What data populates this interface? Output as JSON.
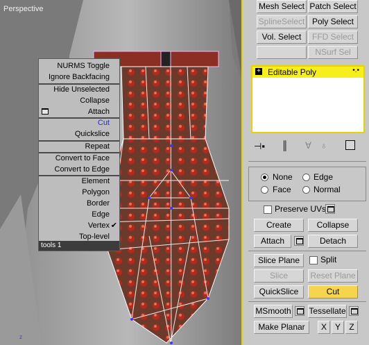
{
  "viewport": {
    "label": "Perspective"
  },
  "quad_menu": {
    "items": [
      {
        "label": "NURMS Toggle"
      },
      {
        "label": "Ignore Backfacing"
      },
      {
        "label": "Hide Unselected"
      },
      {
        "label": "Collapse"
      },
      {
        "label": "Attach"
      },
      {
        "label": "Cut"
      },
      {
        "label": "Quickslice"
      },
      {
        "label": "Repeat"
      },
      {
        "label": "Convert to Face"
      },
      {
        "label": "Convert to Edge"
      },
      {
        "label": "Element"
      },
      {
        "label": "Polygon"
      },
      {
        "label": "Border"
      },
      {
        "label": "Edge"
      },
      {
        "label": "Vertex"
      },
      {
        "label": "Top-level"
      }
    ],
    "footer": "tools 1"
  },
  "modifier_buttons": {
    "mesh_select": "Mesh Select",
    "patch_select": "Patch Select",
    "spline_select": "SplineSelect",
    "poly_select": "Poly Select",
    "vol_select": "Vol. Select",
    "ffd_select": "FFD Select",
    "nsurf_sel": "NSurf Sel"
  },
  "modifier_stack": {
    "items": [
      {
        "label": "Editable Poly",
        "expand": "+"
      }
    ]
  },
  "selection": {
    "none": "None",
    "edge": "Edge",
    "face": "Face",
    "normal": "Normal",
    "selected": "None"
  },
  "edit": {
    "preserve_uvs": "Preserve UVs",
    "create": "Create",
    "collapse": "Collapse",
    "attach": "Attach",
    "detach": "Detach",
    "slice_plane": "Slice Plane",
    "split": "Split",
    "slice": "Slice",
    "reset_plane": "Reset Plane",
    "quickslice": "QuickSlice",
    "cut": "Cut",
    "msmooth": "MSmooth",
    "tessellate": "Tessellate",
    "make_planar": "Make Planar",
    "x": "X",
    "y": "Y",
    "z": "Z"
  },
  "colors": {
    "accent": "#e8d200",
    "active_button": "#f5d44e",
    "highlight_text": "#2a2ad0"
  }
}
